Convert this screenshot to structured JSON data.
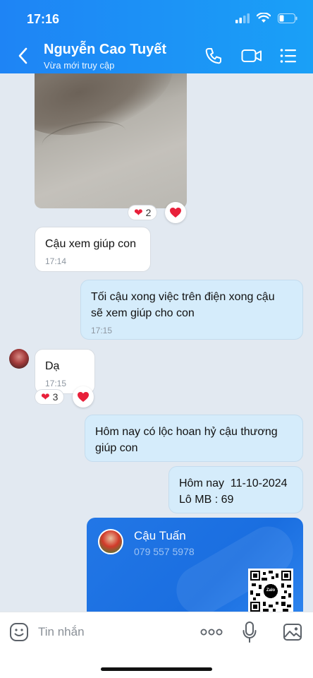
{
  "status_bar": {
    "time": "17:16"
  },
  "header": {
    "contact_name": "Nguyễn Cao Tuyết",
    "contact_status": "Vừa mới truy cập"
  },
  "messages": [
    {
      "id": "m1",
      "direction": "in",
      "text": "Cậu xem giúp con",
      "time": "17:14"
    },
    {
      "id": "m2",
      "direction": "out",
      "text_lines": [
        "Tối cậu xong việc trên điện xong cậu",
        "sẽ xem giúp cho con"
      ],
      "time": "17:15"
    },
    {
      "id": "m3",
      "direction": "in",
      "text": "Dạ",
      "time": "17:15"
    },
    {
      "id": "m4",
      "direction": "out",
      "text_lines": [
        "Hôm nay có lộc hoan hỷ cậu thương",
        "giúp con"
      ]
    },
    {
      "id": "m5",
      "direction": "out",
      "text_lines": [
        "Hôm nay  11-10-2024",
        "Lô MB : 69"
      ]
    }
  ],
  "reactions": {
    "photo": {
      "emoji": "❤",
      "count": "2"
    },
    "m3": {
      "emoji": "❤",
      "count": "3"
    }
  },
  "contact_card": {
    "name": "Cậu Tuấn",
    "phone": "079 557 5978",
    "qr_logo": "Zalo"
  },
  "input": {
    "placeholder": "Tin nhắn"
  },
  "colors": {
    "header": "#1e84f5",
    "outgoing_bubble": "#d5ecfb",
    "incoming_bubble": "#ffffff",
    "chat_bg": "#e2e9f1",
    "heart": "#e8203a"
  },
  "icons": [
    "back-icon",
    "phone-icon",
    "video-icon",
    "menu-icon",
    "sticker-icon",
    "more-icon",
    "mic-icon",
    "image-icon",
    "heart-icon"
  ]
}
